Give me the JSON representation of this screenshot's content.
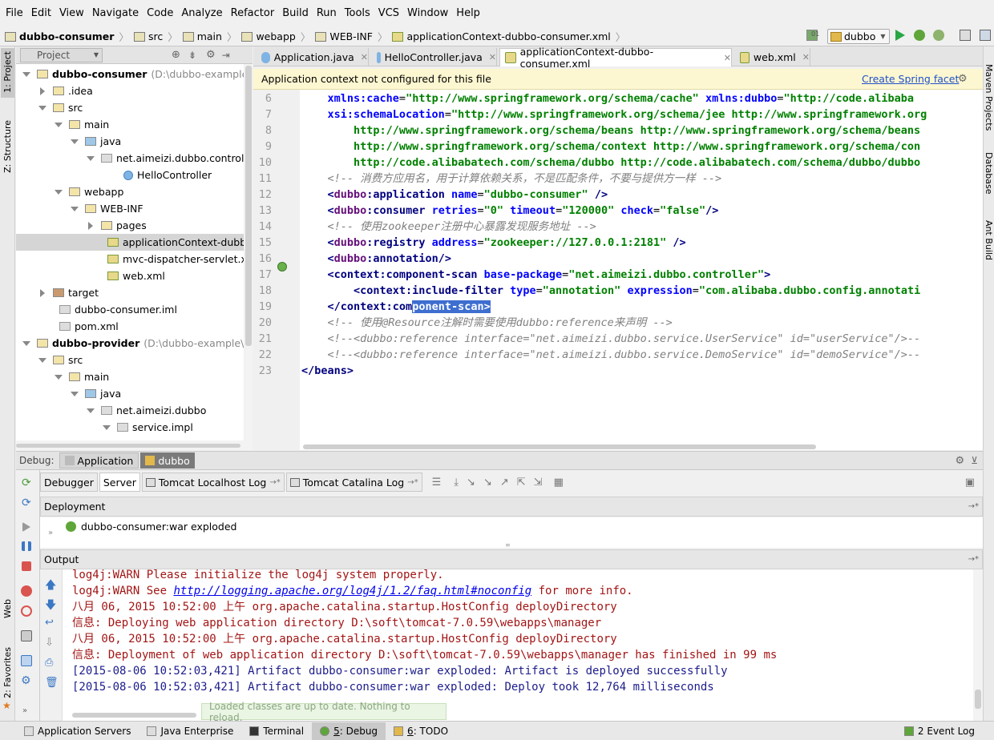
{
  "menu": [
    "File",
    "Edit",
    "View",
    "Navigate",
    "Code",
    "Analyze",
    "Refactor",
    "Build",
    "Run",
    "Tools",
    "VCS",
    "Window",
    "Help"
  ],
  "breadcrumb": [
    "dubbo-consumer",
    "src",
    "main",
    "webapp",
    "WEB-INF",
    "applicationContext-dubbo-consumer.xml"
  ],
  "run_config": "dubbo",
  "left_tool_windows": {
    "project": "1: Project",
    "structure": "Z: Structure",
    "web": "Web",
    "favorites": "2: Favorites"
  },
  "right_tool_windows": {
    "maven": "Maven Projects",
    "database": "Database",
    "ant": "Ant Build"
  },
  "project_panel": {
    "title": "Project",
    "tree": [
      {
        "label": "dubbo-consumer",
        "hint": "(D:\\dubbo-example\\du",
        "bold": true,
        "level": 0,
        "exp": "d",
        "icon": "fic"
      },
      {
        "label": ".idea",
        "level": 1,
        "exp": "r",
        "icon": "fic"
      },
      {
        "label": "src",
        "level": 1,
        "exp": "d",
        "icon": "fic"
      },
      {
        "label": "main",
        "level": 2,
        "exp": "d",
        "icon": "fic"
      },
      {
        "label": "java",
        "level": 3,
        "exp": "d",
        "icon": "fic blue"
      },
      {
        "label": "net.aimeizi.dubbo.controller",
        "level": 4,
        "exp": "d",
        "icon": "fic pkg"
      },
      {
        "label": "HelloController",
        "level": 5,
        "exp": "",
        "icon": "fic cls"
      },
      {
        "label": "webapp",
        "level": 2,
        "exp": "d",
        "icon": "fic"
      },
      {
        "label": "WEB-INF",
        "level": 3,
        "exp": "d",
        "icon": "fic"
      },
      {
        "label": "pages",
        "level": 4,
        "exp": "r",
        "icon": "fic"
      },
      {
        "label": "applicationContext-dubb",
        "level": 4,
        "exp": "",
        "icon": "fic xml"
      },
      {
        "label": "mvc-dispatcher-servlet.x",
        "level": 4,
        "exp": "",
        "icon": "fic xml"
      },
      {
        "label": "web.xml",
        "level": 4,
        "exp": "",
        "icon": "fic xml"
      },
      {
        "label": "target",
        "level": 1,
        "exp": "r",
        "icon": "fic brown"
      },
      {
        "label": "dubbo-consumer.iml",
        "level": 1,
        "exp": "",
        "icon": "fic pkg"
      },
      {
        "label": "pom.xml",
        "level": 1,
        "exp": "",
        "icon": "fic pkg"
      },
      {
        "label": "dubbo-provider",
        "hint": "(D:\\dubbo-example\\dub",
        "bold": true,
        "level": 0,
        "exp": "d",
        "icon": "fic"
      },
      {
        "label": "src",
        "level": 1,
        "exp": "d",
        "icon": "fic"
      },
      {
        "label": "main",
        "level": 2,
        "exp": "d",
        "icon": "fic"
      },
      {
        "label": "java",
        "level": 3,
        "exp": "d",
        "icon": "fic blue"
      },
      {
        "label": "net.aimeizi.dubbo",
        "level": 4,
        "exp": "d",
        "icon": "fic pkg"
      },
      {
        "label": "service.impl",
        "level": 5,
        "exp": "d",
        "icon": "fic pkg"
      }
    ]
  },
  "editor_tabs": [
    "Application.java",
    "HelloController.java",
    "applicationContext-dubbo-consumer.xml",
    "web.xml"
  ],
  "banner": {
    "message": "Application context not configured for this file",
    "link": "Create Spring facet"
  },
  "code_lines": [
    {
      "n": "6",
      "html": "    <span class='at'>xmlns:cache</span>=<span class='vl'>\"http://www.springframework.org/schema/cache\"</span> <span class='at'>xmlns:dubbo</span>=<span class='vl'>\"http://code.alibaba</span>"
    },
    {
      "n": "7",
      "html": "    <span class='at'>xsi:schemaLocation</span>=<span class='vl'>\"http://www.springframework.org/schema/jee http://www.springframework.org</span>"
    },
    {
      "n": "8",
      "html": "        <span class='vl'>http://www.springframework.org/schema/beans http://www.springframework.org/schema/beans</span>"
    },
    {
      "n": "9",
      "html": "        <span class='vl'>http://www.springframework.org/schema/context http://www.springframework.org/schema/con</span>"
    },
    {
      "n": "10",
      "html": "        <span class='vl'>http://code.alibabatech.com/schema/dubbo http://code.alibabatech.com/schema/dubbo/dubbo</span>"
    },
    {
      "n": "11",
      "html": "    <span class='cm'>&lt;!-- 消费方应用名，用于计算依赖关系，不是匹配条件，不要与提供方一样 --&gt;</span>"
    },
    {
      "n": "12",
      "html": "    <span class='tg'>&lt;</span><span class='ns'>dubbo</span><span class='tg'>:application</span> <span class='at'>name</span>=<span class='vl'>\"dubbo-consumer\"</span> <span class='tg'>/&gt;</span>"
    },
    {
      "n": "13",
      "html": "    <span class='tg'>&lt;</span><span class='ns'>dubbo</span><span class='tg'>:consumer</span> <span class='at'>retries</span>=<span class='vl'>\"0\"</span> <span class='at'>timeout</span>=<span class='vl'>\"120000\"</span> <span class='at'>check</span>=<span class='vl'>\"false\"</span><span class='tg'>/&gt;</span>"
    },
    {
      "n": "14",
      "html": "    <span class='cm'>&lt;!-- 使用zookeeper注册中心暴露发现服务地址 --&gt;</span>"
    },
    {
      "n": "15",
      "html": "    <span class='tg'>&lt;</span><span class='ns'>dubbo</span><span class='tg'>:registry</span> <span class='at'>address</span>=<span class='vl'>\"zookeeper://127.0.0.1:2181\"</span> <span class='tg'>/&gt;</span>"
    },
    {
      "n": "16",
      "html": "    <span class='tg'>&lt;</span><span class='ns'>dubbo</span><span class='tg'>:annotation/&gt;</span>"
    },
    {
      "n": "17",
      "html": "    <span class='tg'>&lt;context:component-scan</span> <span class='at'>base-package</span>=<span class='vl'>\"net.aimeizi.dubbo.controller\"</span><span class='tg'>&gt;</span>"
    },
    {
      "n": "18",
      "html": "        <span class='tg'>&lt;context:include-filter</span> <span class='at'>type</span>=<span class='vl'>\"annotation\"</span> <span class='at'>expression</span>=<span class='vl'>\"com.alibaba.dubbo.config.annotati</span>"
    },
    {
      "n": "19",
      "html": "    <span class='tg'>&lt;/context:com</span><span class='tg hl'>ponent-scan&gt;</span>"
    },
    {
      "n": "20",
      "html": "    <span class='cm'>&lt;!-- 使用@Resource注解时需要使用dubbo:reference来声明 --&gt;</span>"
    },
    {
      "n": "21",
      "html": "    <span class='cm'>&lt;!--&lt;dubbo:reference interface=\"net.aimeizi.dubbo.service.UserService\" id=\"userService\"/&gt;--</span>"
    },
    {
      "n": "22",
      "html": "    <span class='cm'>&lt;!--&lt;dubbo:reference interface=\"net.aimeizi.dubbo.service.DemoService\" id=\"demoService\"/&gt;--</span>"
    },
    {
      "n": "23",
      "html": "<span class='tg'>&lt;/beans&gt;</span>"
    }
  ],
  "debug": {
    "label": "Debug:",
    "tabs": [
      "Application",
      "dubbo"
    ],
    "subtabs": [
      "Debugger",
      "Server",
      "Tomcat Localhost Log",
      "Tomcat Catalina Log"
    ],
    "deployment_title": "Deployment",
    "deployment_item": "dubbo-consumer:war exploded",
    "output_title": "Output",
    "output_lines": [
      {
        "cls": "red",
        "text": "log4j:WARN Please initialize the log4j system properly."
      },
      {
        "cls": "red",
        "pre": "log4j:WARN See ",
        "link": "http://logging.apache.org/log4j/1.2/faq.html#noconfig",
        "post": " for more info."
      },
      {
        "cls": "red",
        "text": "八月 06, 2015 10:52:00 上午 org.apache.catalina.startup.HostConfig deployDirectory"
      },
      {
        "cls": "red",
        "text": "信息: Deploying web application directory D:\\soft\\tomcat-7.0.59\\webapps\\manager"
      },
      {
        "cls": "red",
        "text": "八月 06, 2015 10:52:00 上午 org.apache.catalina.startup.HostConfig deployDirectory"
      },
      {
        "cls": "red",
        "text": "信息: Deployment of web application directory D:\\soft\\tomcat-7.0.59\\webapps\\manager has finished in 99 ms"
      },
      {
        "cls": "blu",
        "text": "[2015-08-06 10:52:03,421] Artifact dubbo-consumer:war exploded: Artifact is deployed successfully"
      },
      {
        "cls": "blu",
        "text": "[2015-08-06 10:52:03,421] Artifact dubbo-consumer:war exploded: Deploy took 12,764 milliseconds"
      }
    ],
    "toast": "Loaded classes are up to date. Nothing to reload."
  },
  "statusbar": [
    {
      "label": "Application Servers",
      "key": ""
    },
    {
      "label": "Java Enterprise",
      "key": ""
    },
    {
      "label": "Terminal",
      "key": ""
    },
    {
      "label": "Debug",
      "key": "5"
    },
    {
      "label": "TODO",
      "key": "6"
    }
  ],
  "event_log": {
    "count": "2",
    "label": "Event Log"
  }
}
